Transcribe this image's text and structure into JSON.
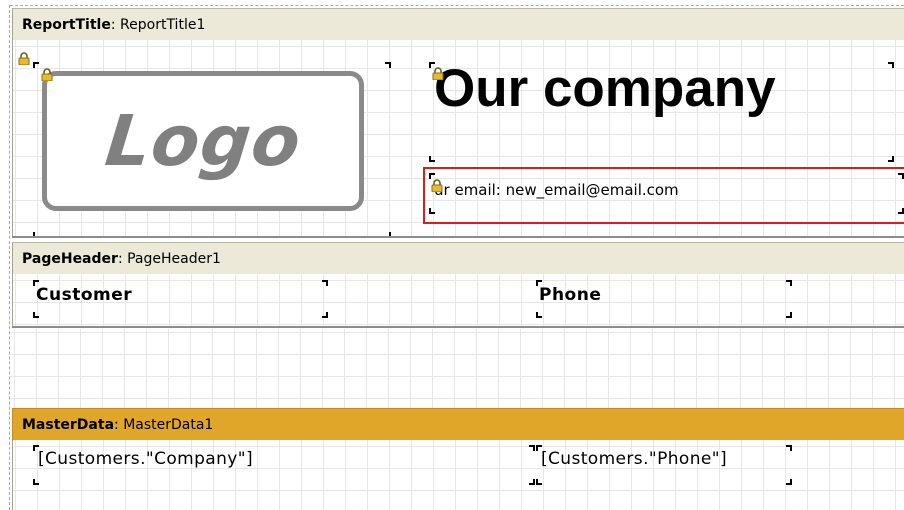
{
  "bands": {
    "report_title": {
      "type_label": "ReportTitle",
      "name": "ReportTitle1"
    },
    "page_header": {
      "type_label": "PageHeader",
      "name": "PageHeader1"
    },
    "master_data": {
      "type_label": "MasterData",
      "name": "MasterData1"
    }
  },
  "separator": ": ",
  "objects": {
    "logo": {
      "text": "Logo",
      "icon": "lock-icon"
    },
    "company": {
      "text": "Our company",
      "icon": "lock-icon"
    },
    "email": {
      "text": "ur email: new_email@email.com",
      "icon": "lock-icon"
    },
    "header_customer": {
      "text": "Customer"
    },
    "header_phone": {
      "text": "Phone"
    },
    "data_company": {
      "text": "[Customers.\"Company\"]"
    },
    "data_phone": {
      "text": "[Customers.\"Phone\"]"
    }
  },
  "colors": {
    "band_header": "#ece9d8",
    "master_band_header": "#e0a62a",
    "selection_border": "#e01a1a",
    "logo_gray": "#808080",
    "grid_line": "#e7e7e7"
  }
}
